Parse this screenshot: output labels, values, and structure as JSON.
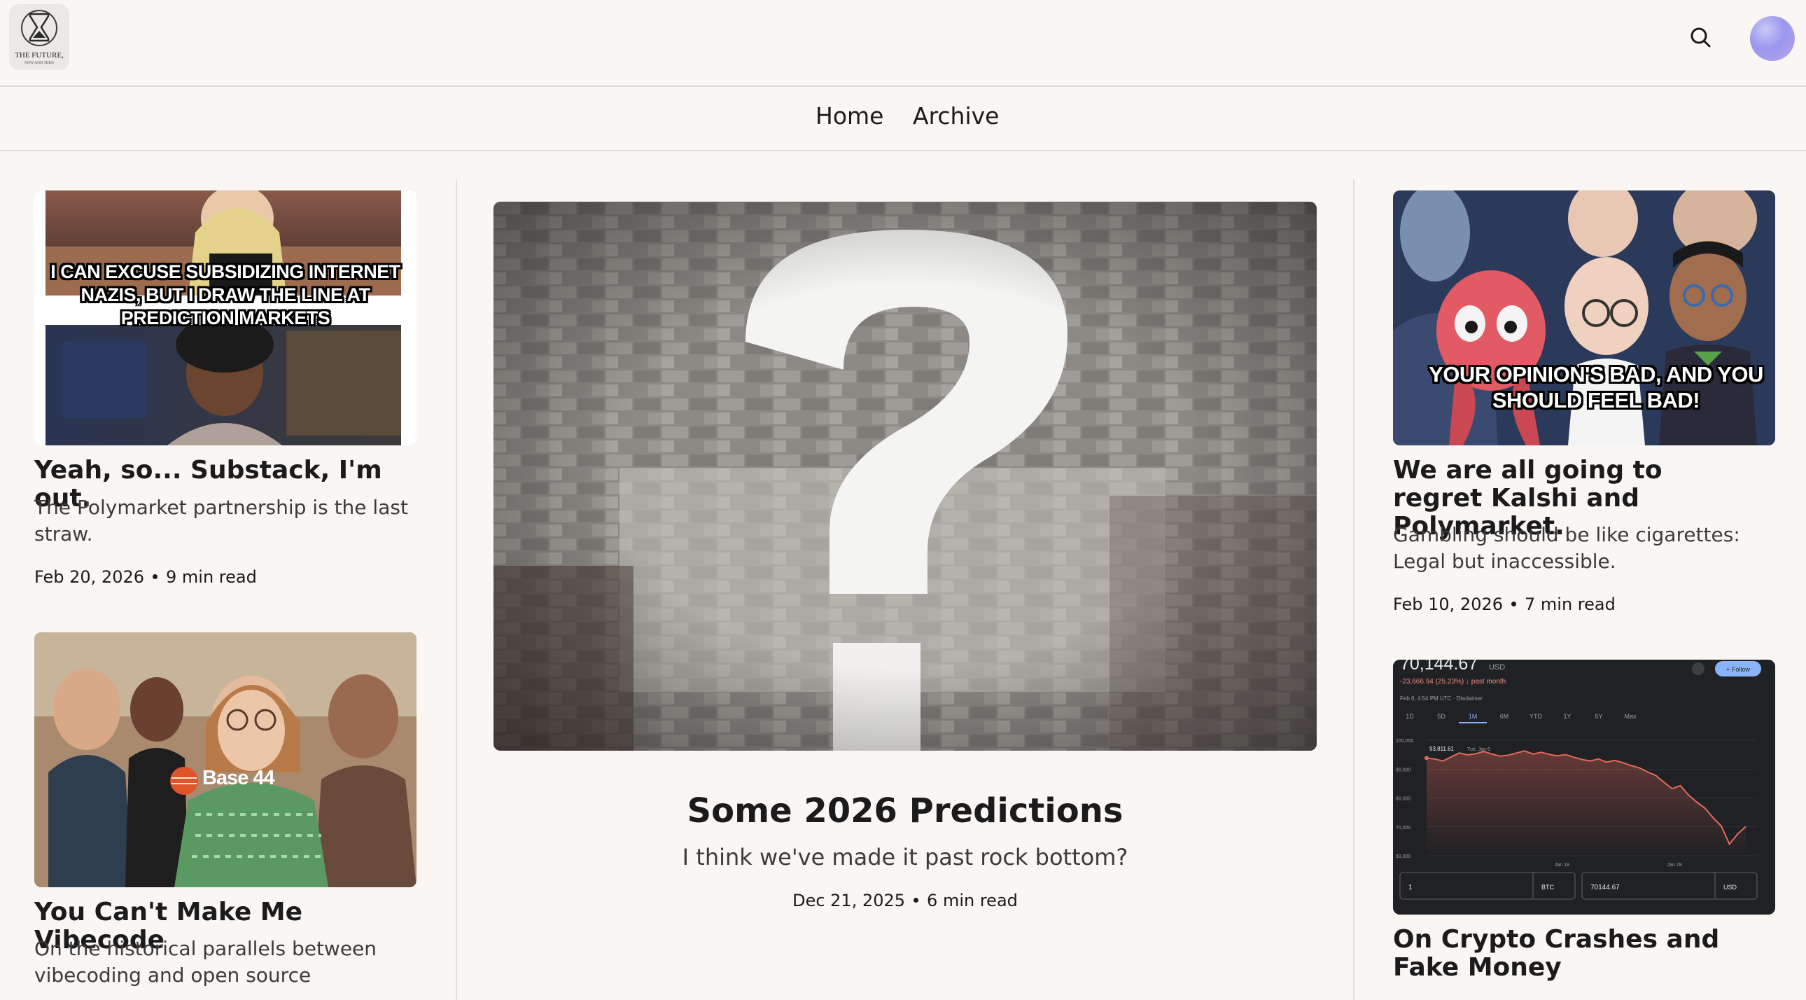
{
  "header": {
    "logo": {
      "line1": "THE FUTURE,",
      "line2": "NOW AND THEN"
    },
    "search_icon": "search-icon",
    "avatar": "user-avatar"
  },
  "nav": {
    "items": [
      {
        "label": "Home"
      },
      {
        "label": "Archive"
      }
    ]
  },
  "posts": {
    "left": [
      {
        "title": "Yeah, so... Substack, I'm out.",
        "subtitle": "The Polymarket partnership is the last straw.",
        "date": "Feb 20, 2026",
        "read_time": "9 min read",
        "image_caption": "I CAN EXCUSE SUBSIDIZING INTERNET NAZIS, BUT I DRAW THE LINE AT PREDICTION MARKETS"
      },
      {
        "title": "You Can't Make Me Vibecode",
        "subtitle": "On the historical parallels between vibecoding and open source",
        "image_caption": "Base 44"
      }
    ],
    "featured": {
      "title": "Some 2026 Predictions",
      "subtitle": "I think we've made it past rock bottom?",
      "date": "Dec 21, 2025",
      "read_time": "6 min read"
    },
    "right": [
      {
        "title": "We are all going to regret Kalshi and Polymarket.",
        "subtitle": "Gambling should be like cigarettes: Legal but inaccessible.",
        "date": "Feb 10, 2026",
        "read_time": "7 min read",
        "image_caption": "YOUR OPINION'S BAD, AND YOU SHOULD FEEL BAD!"
      },
      {
        "title": "On Crypto Crashes and Fake Money",
        "image": {
          "price": "70,144.67",
          "currency": "USD",
          "change": "-23,666.94 (25.23%) ↓ past month",
          "timestamp": "Feb 6, 4:54 PM UTC · Disclaimer",
          "follow_label": "+ Follow",
          "ranges": [
            "1D",
            "5D",
            "1M",
            "6M",
            "YTD",
            "1Y",
            "5Y",
            "Max"
          ],
          "selected_range": "1M",
          "y_ticks": [
            "100,000",
            "90,000",
            "80,000",
            "70,000",
            "60,000"
          ],
          "x_ticks": [
            "Jan 18",
            "Jan 29"
          ],
          "hover_value": "93,811.61",
          "hover_date": "Tue, Jan 6",
          "converter": {
            "amount": "1",
            "from": "BTC",
            "result": "70144.67",
            "to": "USD"
          },
          "price_series": [
            93811,
            93500,
            92800,
            94200,
            95600,
            94900,
            95300,
            96100,
            95200,
            94500,
            94800,
            95600,
            96300,
            95200,
            95800,
            95100,
            94600,
            95000,
            94100,
            93300,
            92800,
            93500,
            92400,
            93000,
            92200,
            91200,
            90400,
            89000,
            87800,
            85400,
            83200,
            84300,
            81000,
            78600,
            76500,
            73200,
            70300,
            64000,
            67500,
            70144
          ],
          "y_range": [
            60000,
            100000
          ]
        }
      }
    ]
  }
}
